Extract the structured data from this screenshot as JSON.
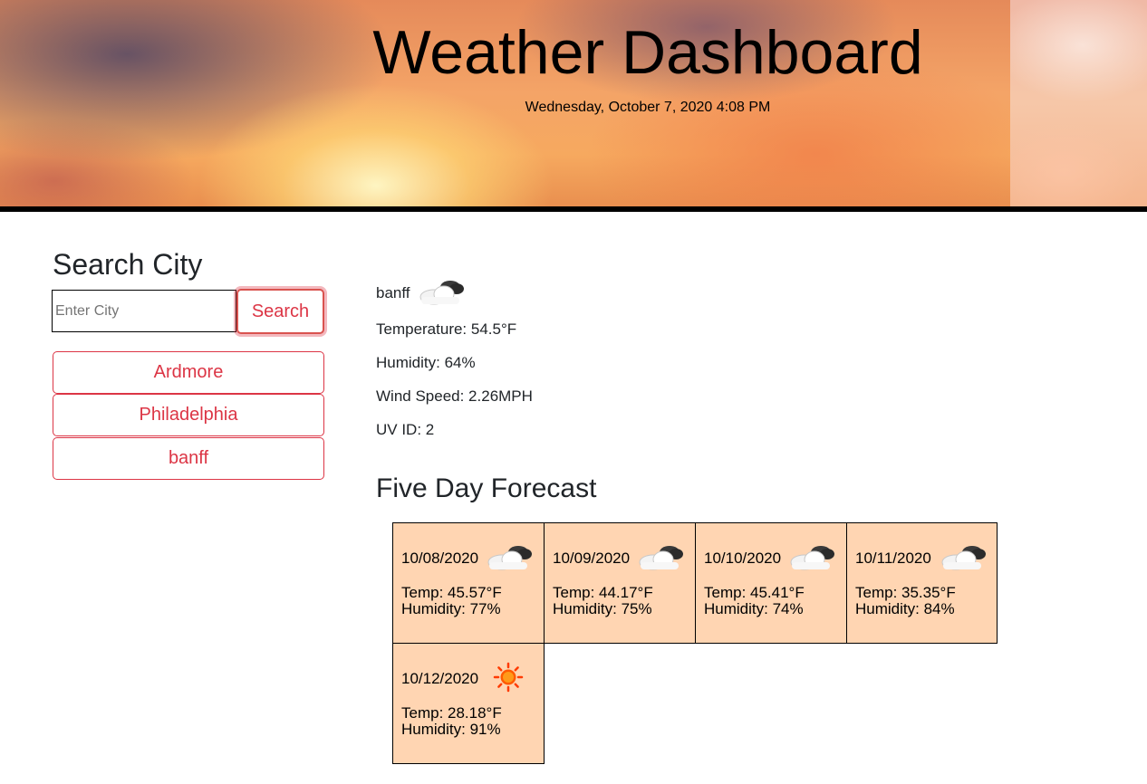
{
  "header": {
    "title": "Weather Dashboard",
    "datetime": "Wednesday, October 7, 2020 4:08 PM"
  },
  "search": {
    "heading": "Search City",
    "placeholder": "Enter City",
    "value": "",
    "button_label": "Search",
    "history": [
      "Ardmore",
      "Philadelphia",
      "banff"
    ]
  },
  "current": {
    "city": "banff",
    "icon": "partly-cloudy-icon",
    "temperature": "Temperature: 54.5°F",
    "humidity": "Humidity: 64%",
    "wind": "Wind Speed: 2.26MPH",
    "uv": "UV ID: 2"
  },
  "forecast": {
    "heading": "Five Day Forecast",
    "days": [
      {
        "date": "10/08/2020",
        "icon": "partly-cloudy-icon",
        "temp": "Temp: 45.57°F",
        "humidity": "Humidity: 77%"
      },
      {
        "date": "10/09/2020",
        "icon": "partly-cloudy-icon",
        "temp": "Temp: 44.17°F",
        "humidity": "Humidity: 75%"
      },
      {
        "date": "10/10/2020",
        "icon": "partly-cloudy-icon",
        "temp": "Temp: 45.41°F",
        "humidity": "Humidity: 74%"
      },
      {
        "date": "10/11/2020",
        "icon": "partly-cloudy-icon",
        "temp": "Temp: 35.35°F",
        "humidity": "Humidity: 84%"
      },
      {
        "date": "10/12/2020",
        "icon": "sun-icon",
        "temp": "Temp: 28.18°F",
        "humidity": "Humidity: 91%"
      }
    ]
  },
  "colors": {
    "accent": "#dc3545",
    "card_background": "#ffd5b2"
  }
}
